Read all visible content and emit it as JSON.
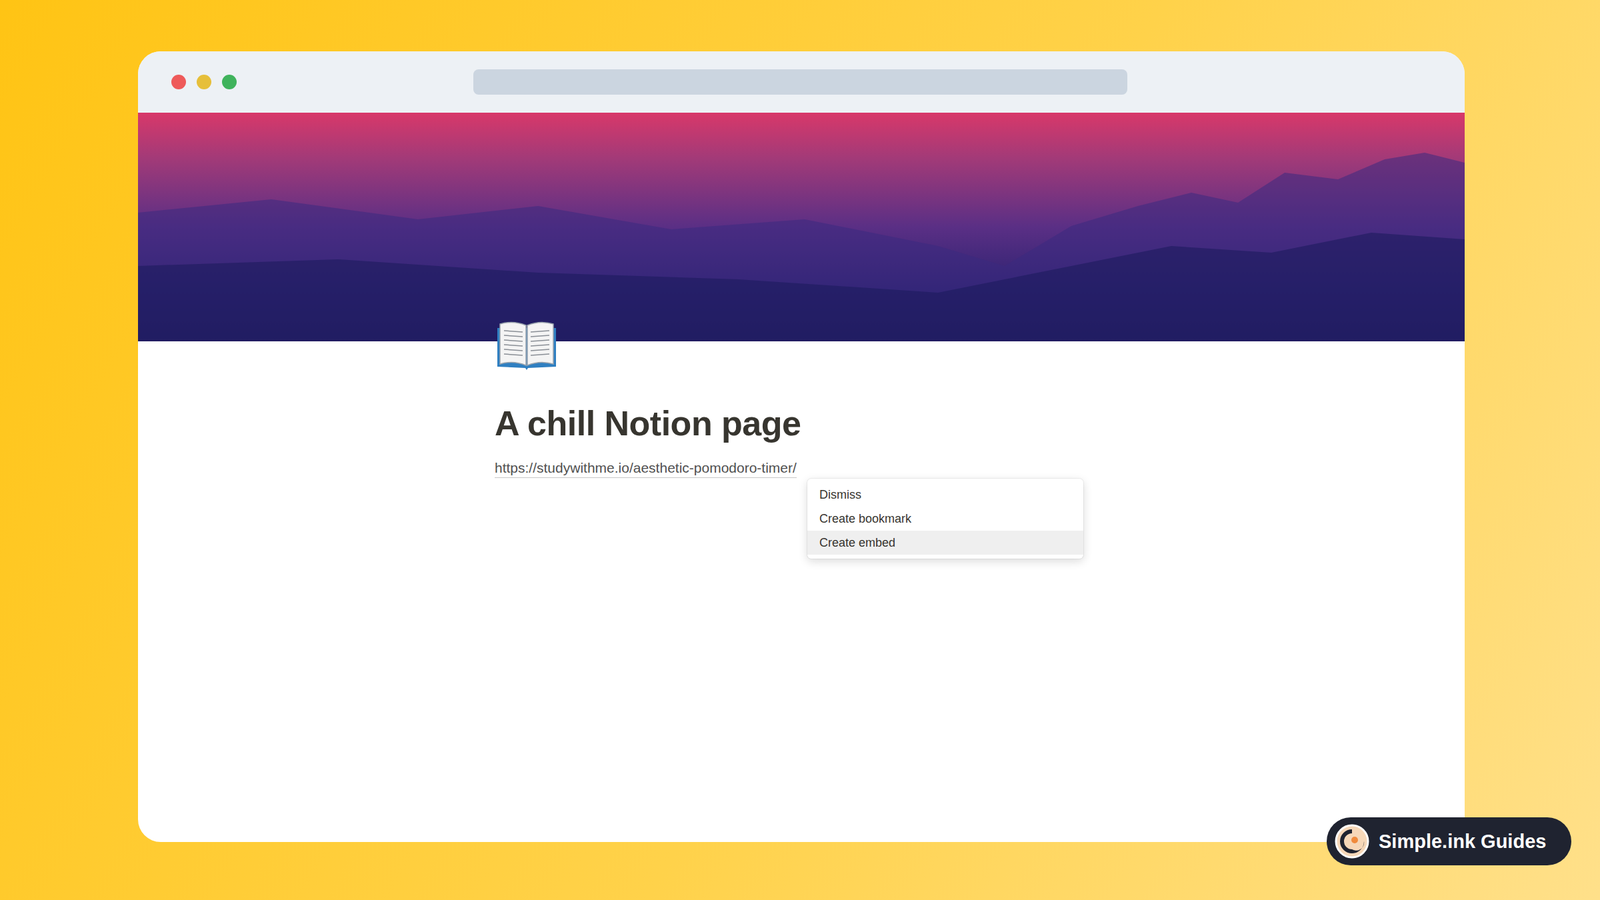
{
  "page": {
    "title": "A chill Notion page",
    "link": "https://studywithme.io/aesthetic-pomodoro-timer/"
  },
  "menu": {
    "items": [
      {
        "label": "Dismiss",
        "selected": false
      },
      {
        "label": "Create bookmark",
        "selected": false
      },
      {
        "label": "Create embed",
        "selected": true
      }
    ]
  },
  "badge": {
    "label": "Simple.ink Guides"
  }
}
